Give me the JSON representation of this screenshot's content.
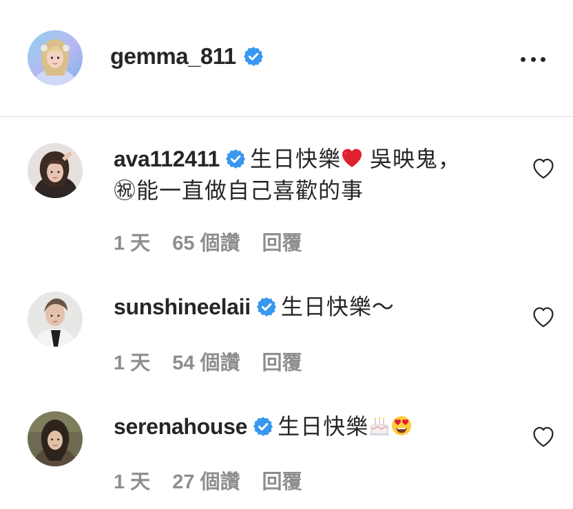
{
  "post": {
    "username": "gemma_811",
    "verified": true,
    "more_icon": "more-horizontal-icon"
  },
  "comments": [
    {
      "username": "ava112411",
      "verified": true,
      "text_a": "生日快樂",
      "emoji_a": "red-heart",
      "text_b": " 吳映鬼，",
      "text_c": "㊗能一直做自己喜歡的事",
      "time": "1 天",
      "likes": "65 個讚",
      "reply": "回覆"
    },
    {
      "username": "sunshineelaii",
      "verified": true,
      "text_a": "生日快樂～",
      "time": "1 天",
      "likes": "54 個讚",
      "reply": "回覆"
    },
    {
      "username": "serenahouse",
      "verified": true,
      "text_a": "生日快樂",
      "emoji_a": "birthday-cake",
      "emoji_b": "heart-eyes",
      "time": "1 天",
      "likes": "27 個讚",
      "reply": "回覆"
    }
  ],
  "colors": {
    "verified_blue": "#3897f0",
    "text_primary": "#262626",
    "text_secondary": "#8e8e8e",
    "divider": "#dbdbdb"
  }
}
